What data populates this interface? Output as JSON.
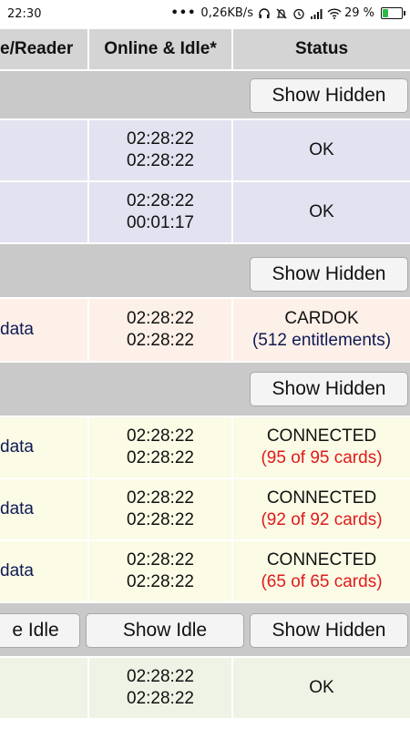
{
  "status_bar": {
    "time": "22:30",
    "dots": "•••",
    "net_speed": "0,26KB/s",
    "battery_percent": "29 %",
    "battery_level": 0.29,
    "icons": [
      "headphones-icon",
      "mute-icon",
      "alarm-icon",
      "signal-icon",
      "wifi-icon",
      "battery-icon"
    ]
  },
  "table": {
    "headers": {
      "reader": "e/Reader",
      "online_idle": "Online & Idle*",
      "status": "Status"
    },
    "buttons": {
      "show_hidden": "Show Hidden",
      "show_idle": "Show Idle",
      "show_idle_partial": "e Idle"
    },
    "rows": [
      {
        "reader": "",
        "times": [
          "02:28:22",
          "02:28:22"
        ],
        "status": "OK",
        "note": ""
      },
      {
        "reader": "",
        "times": [
          "02:28:22",
          "00:01:17"
        ],
        "status": "OK",
        "note": ""
      },
      {
        "reader": "data",
        "times": [
          "02:28:22",
          "02:28:22"
        ],
        "status": "CARDOK",
        "note": "(512 entitlements)"
      },
      {
        "reader": "data",
        "times": [
          "02:28:22",
          "02:28:22"
        ],
        "status": "CONNECTED",
        "note": "(95 of 95 cards)"
      },
      {
        "reader": "data",
        "times": [
          "02:28:22",
          "02:28:22"
        ],
        "status": "CONNECTED",
        "note": "(92 of 92 cards)"
      },
      {
        "reader": "data",
        "times": [
          "02:28:22",
          "02:28:22"
        ],
        "status": "CONNECTED",
        "note": "(65 of 65 cards)"
      },
      {
        "reader": "",
        "times": [
          "02:28:22",
          "02:28:22"
        ],
        "status": "OK",
        "note": ""
      }
    ]
  }
}
